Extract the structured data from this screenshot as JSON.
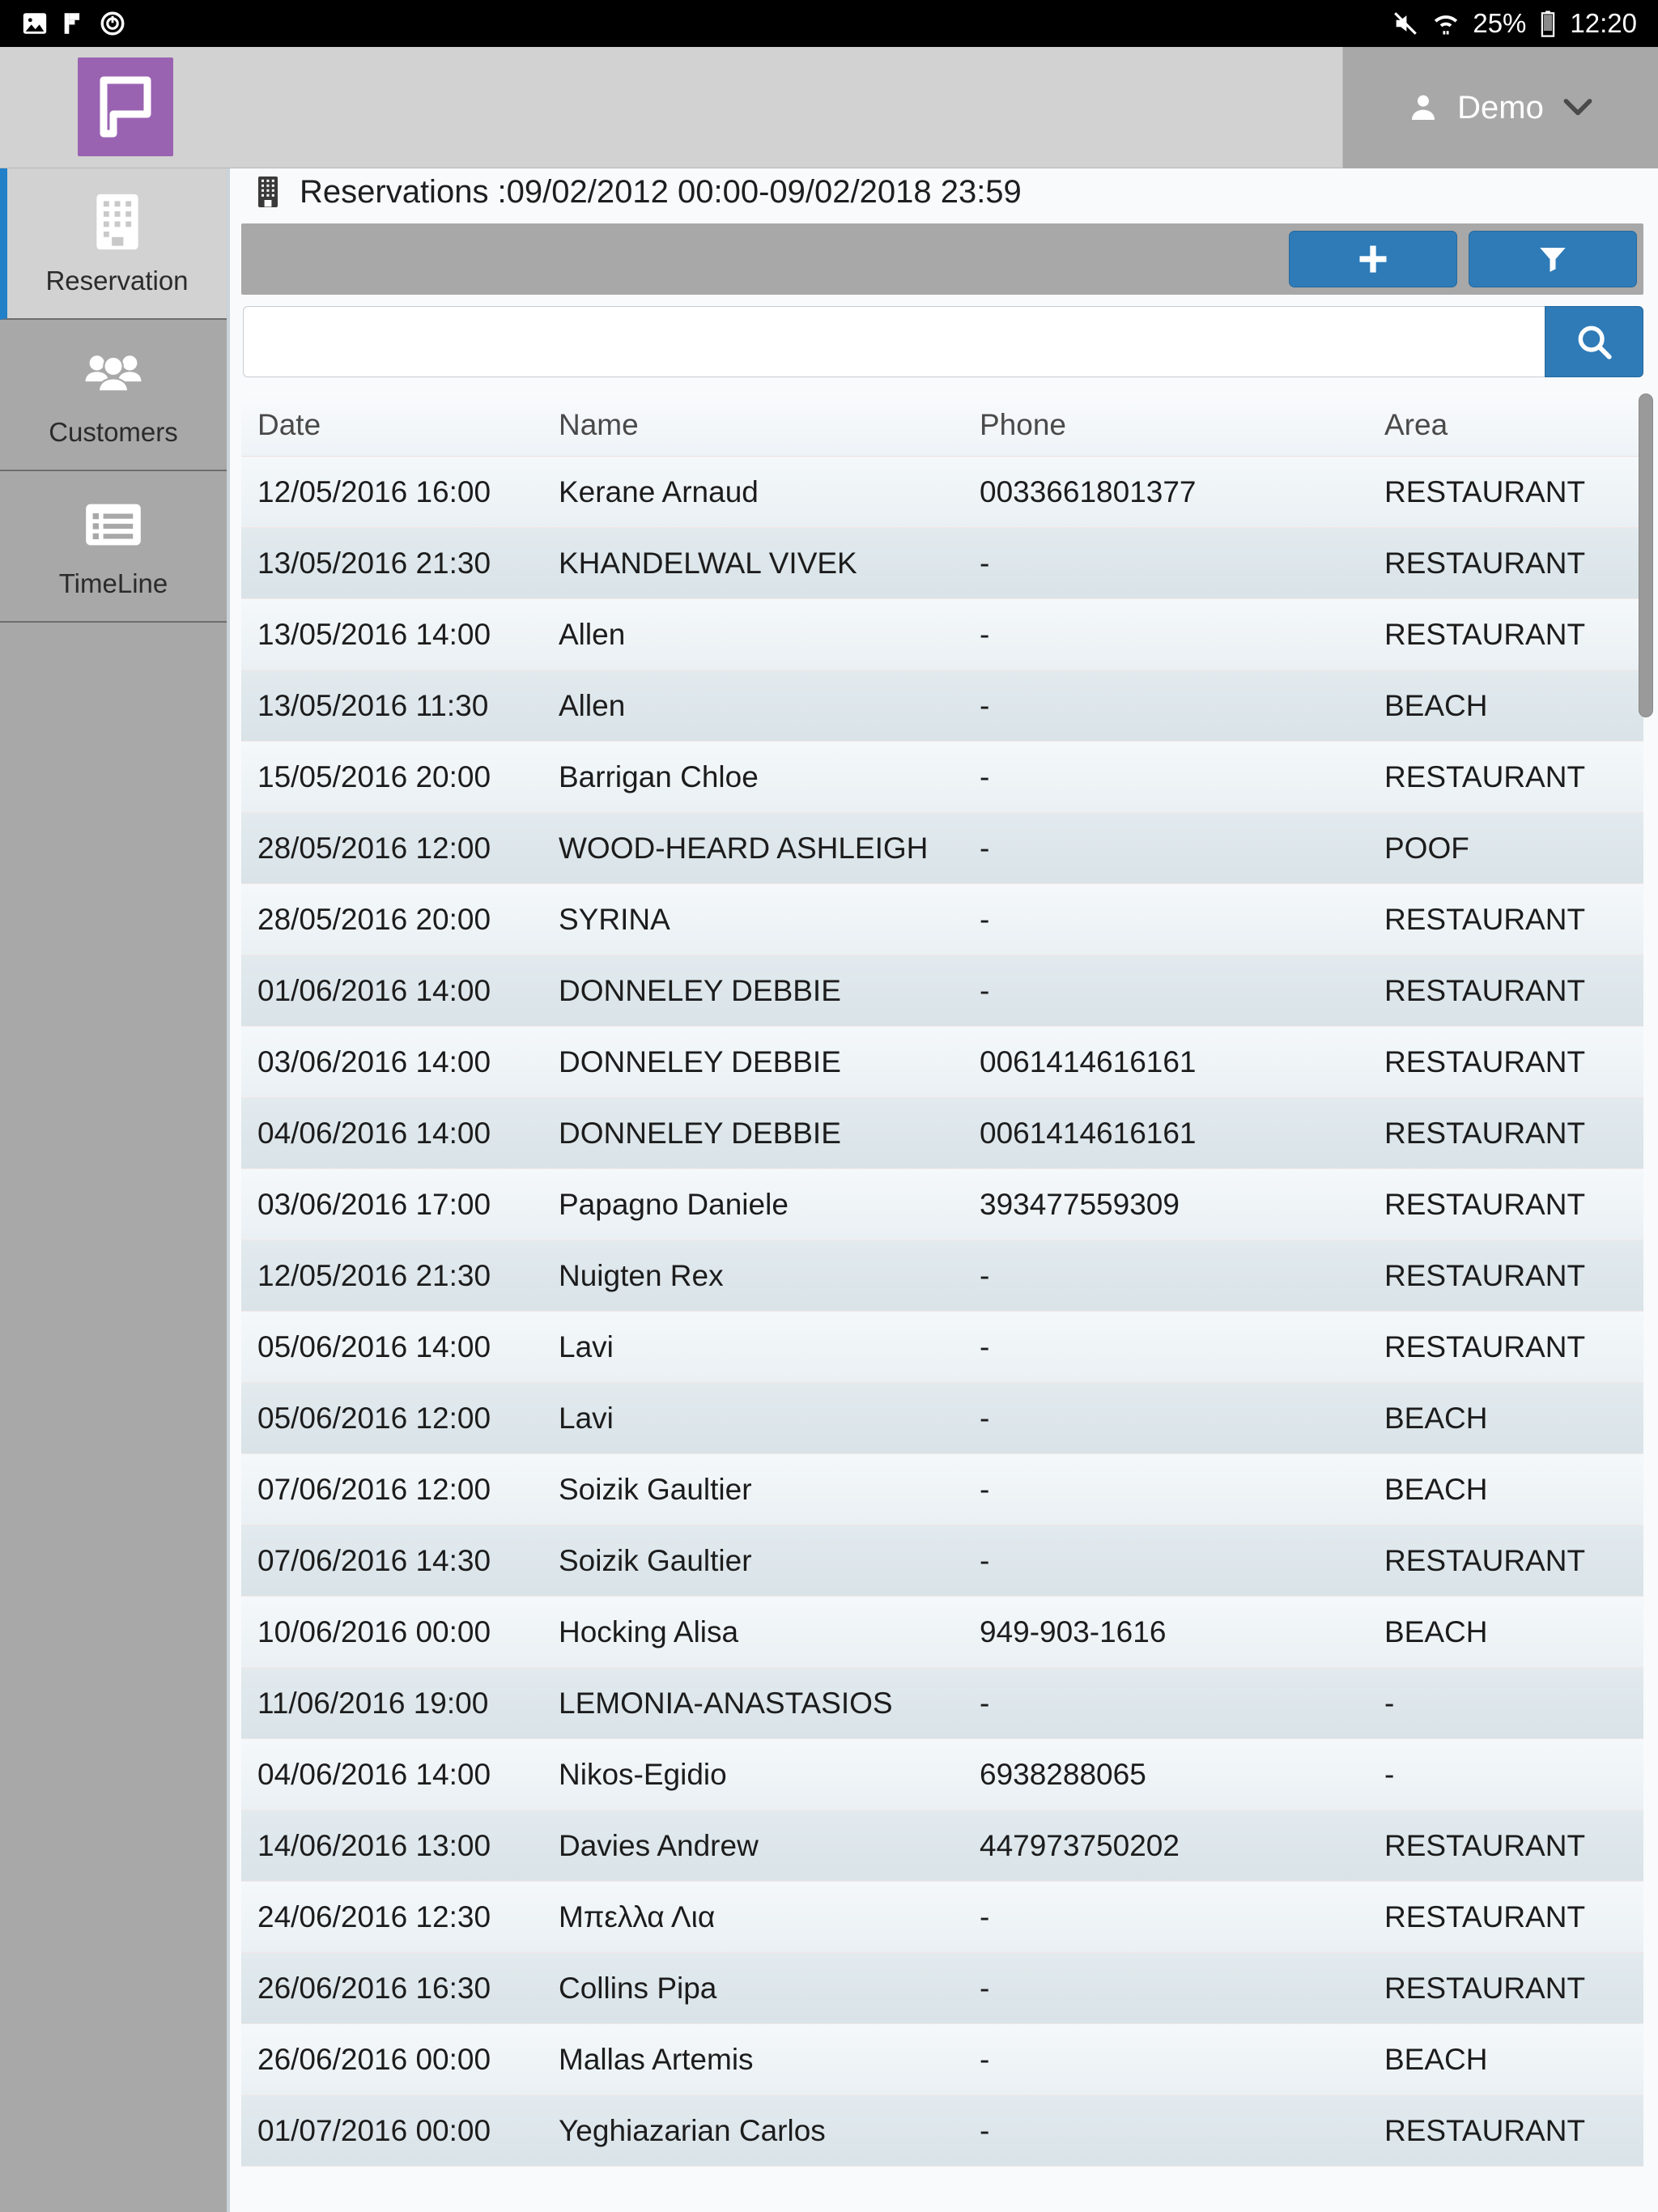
{
  "statusbar": {
    "left_icons": [
      "image-icon",
      "flag-icon",
      "power-sync-icon"
    ],
    "right_icons": [
      "mute-icon",
      "wifi-icon",
      "battery-icon"
    ],
    "battery_percent": "25%",
    "clock": "12:20"
  },
  "appheader": {
    "logo": "app-logo-icon",
    "user_name": "Demo",
    "user_icon": "person-icon",
    "chevron": "chevron-down-icon"
  },
  "sidebar": {
    "items": [
      {
        "label": "Reservation",
        "icon": "building-icon",
        "active": true
      },
      {
        "label": "Customers",
        "icon": "people-group-icon",
        "active": false
      },
      {
        "label": "TimeLine",
        "icon": "list-view-icon",
        "active": false
      }
    ]
  },
  "page": {
    "title": "Reservations :09/02/2012 00:00-09/02/2018 23:59",
    "title_icon": "building-small-icon"
  },
  "toolbar": {
    "add_label": "+",
    "add_icon": "plus-icon",
    "filter_icon": "funnel-icon",
    "accent_color": "#2e7bb8"
  },
  "search": {
    "value": "",
    "placeholder": "",
    "button_icon": "search-icon"
  },
  "table": {
    "columns": [
      "Date",
      "Name",
      "Phone",
      "Area"
    ],
    "rows": [
      {
        "date": "12/05/2016 16:00",
        "name": "Kerane Arnaud",
        "phone": "0033661801377",
        "area": "RESTAURANT"
      },
      {
        "date": "13/05/2016 21:30",
        "name": "KHANDELWAL VIVEK",
        "phone": "-",
        "area": "RESTAURANT"
      },
      {
        "date": "13/05/2016 14:00",
        "name": "Allen",
        "phone": "-",
        "area": "RESTAURANT"
      },
      {
        "date": "13/05/2016 11:30",
        "name": "Allen",
        "phone": "-",
        "area": "BEACH"
      },
      {
        "date": "15/05/2016 20:00",
        "name": "Barrigan Chloe",
        "phone": "-",
        "area": "RESTAURANT"
      },
      {
        "date": "28/05/2016 12:00",
        "name": "WOOD-HEARD ASHLEIGH",
        "phone": "-",
        "area": "POOF"
      },
      {
        "date": "28/05/2016 20:00",
        "name": "SYRINA",
        "phone": "-",
        "area": "RESTAURANT"
      },
      {
        "date": "01/06/2016 14:00",
        "name": "DONNELEY DEBBIE",
        "phone": "-",
        "area": "RESTAURANT"
      },
      {
        "date": "03/06/2016 14:00",
        "name": "DONNELEY DEBBIE",
        "phone": "0061414616161",
        "area": "RESTAURANT"
      },
      {
        "date": "04/06/2016 14:00",
        "name": "DONNELEY DEBBIE",
        "phone": "0061414616161",
        "area": "RESTAURANT"
      },
      {
        "date": "03/06/2016 17:00",
        "name": "Papagno Daniele",
        "phone": "393477559309",
        "area": "RESTAURANT"
      },
      {
        "date": "12/05/2016 21:30",
        "name": "Nuigten Rex",
        "phone": "-",
        "area": "RESTAURANT"
      },
      {
        "date": "05/06/2016 14:00",
        "name": "Lavi",
        "phone": "-",
        "area": "RESTAURANT"
      },
      {
        "date": "05/06/2016 12:00",
        "name": "Lavi",
        "phone": "-",
        "area": "BEACH"
      },
      {
        "date": "07/06/2016 12:00",
        "name": "Soizik Gaultier",
        "phone": "-",
        "area": "BEACH"
      },
      {
        "date": "07/06/2016 14:30",
        "name": "Soizik Gaultier",
        "phone": "-",
        "area": "RESTAURANT"
      },
      {
        "date": "10/06/2016 00:00",
        "name": "Hocking Alisa",
        "phone": "949-903-1616",
        "area": "BEACH"
      },
      {
        "date": "11/06/2016 19:00",
        "name": "LEMONIA-ANASTASIOS",
        "phone": "-",
        "area": "-"
      },
      {
        "date": "04/06/2016 14:00",
        "name": "Nikos-Egidio",
        "phone": "6938288065",
        "area": "-"
      },
      {
        "date": "14/06/2016 13:00",
        "name": "Davies Andrew",
        "phone": "447973750202",
        "area": "RESTAURANT"
      },
      {
        "date": "24/06/2016 12:30",
        "name": "Μπελλα Λια",
        "phone": "-",
        "area": "RESTAURANT"
      },
      {
        "date": "26/06/2016 16:30",
        "name": "Collins Pipa",
        "phone": "-",
        "area": "RESTAURANT"
      },
      {
        "date": "26/06/2016 00:00",
        "name": "Mallas Artemis",
        "phone": "-",
        "area": "BEACH"
      },
      {
        "date": "01/07/2016 00:00",
        "name": "Yeghiazarian Carlos",
        "phone": "-",
        "area": "RESTAURANT"
      }
    ]
  }
}
